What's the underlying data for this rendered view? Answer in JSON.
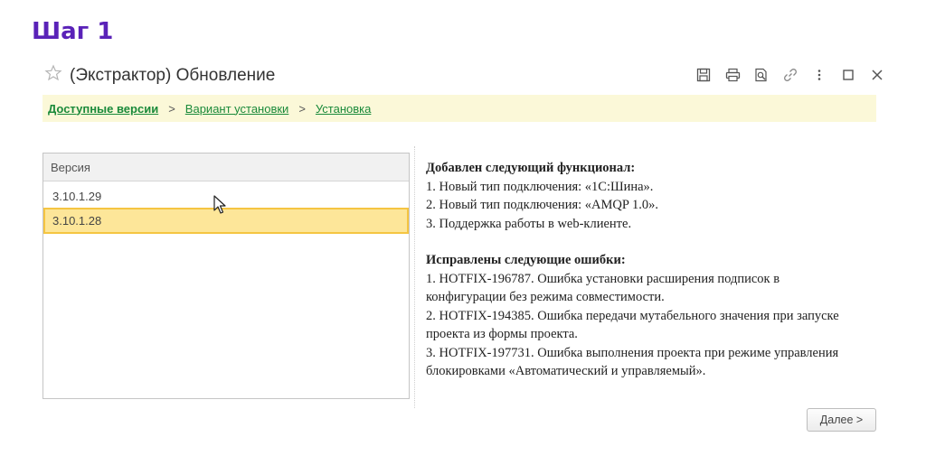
{
  "step": {
    "title": "Шаг 1"
  },
  "window": {
    "title": "(Экстрактор) Обновление",
    "toolbar_icons": [
      "save-icon",
      "print-icon",
      "preview-icon",
      "link-icon",
      "more-icon",
      "maximize-icon",
      "close-icon"
    ]
  },
  "breadcrumb": {
    "items": [
      {
        "label": "Доступные версии",
        "current": true
      },
      {
        "label": "Вариант установки",
        "current": false
      },
      {
        "label": "Установка",
        "current": false
      }
    ],
    "separator": ">"
  },
  "versions_table": {
    "header": "Версия",
    "rows": [
      {
        "version": "3.10.1.29",
        "selected": false
      },
      {
        "version": "3.10.1.28",
        "selected": true
      }
    ]
  },
  "description": {
    "added_heading": "Добавлен следующий функционал:",
    "added_items": [
      "1. Новый тип подключения: «1С:Шина».",
      "2. Новый тип подключения: «AMQP 1.0».",
      "3. Поддержка работы в web-клиенте."
    ],
    "fixed_heading": "Исправлены следующие ошибки:",
    "fixed_items": [
      "1. HOTFIX-196787. Ошибка установки расширения подписок в конфигурации без режима совместимости.",
      "2. HOTFIX-194385. Ошибка передачи мутабельного значения при запуске проекта из формы проекта.",
      "3. HOTFIX-197731. Ошибка выполнения проекта при режиме управления блокировками «Автоматический и управляемый»."
    ]
  },
  "next_button": {
    "label": "Далее >"
  },
  "colors": {
    "step_title": "#5a22b8",
    "link": "#1a8a3a",
    "breadcrumb_bg": "#fbf8d8",
    "selected_row": "#fde699"
  }
}
